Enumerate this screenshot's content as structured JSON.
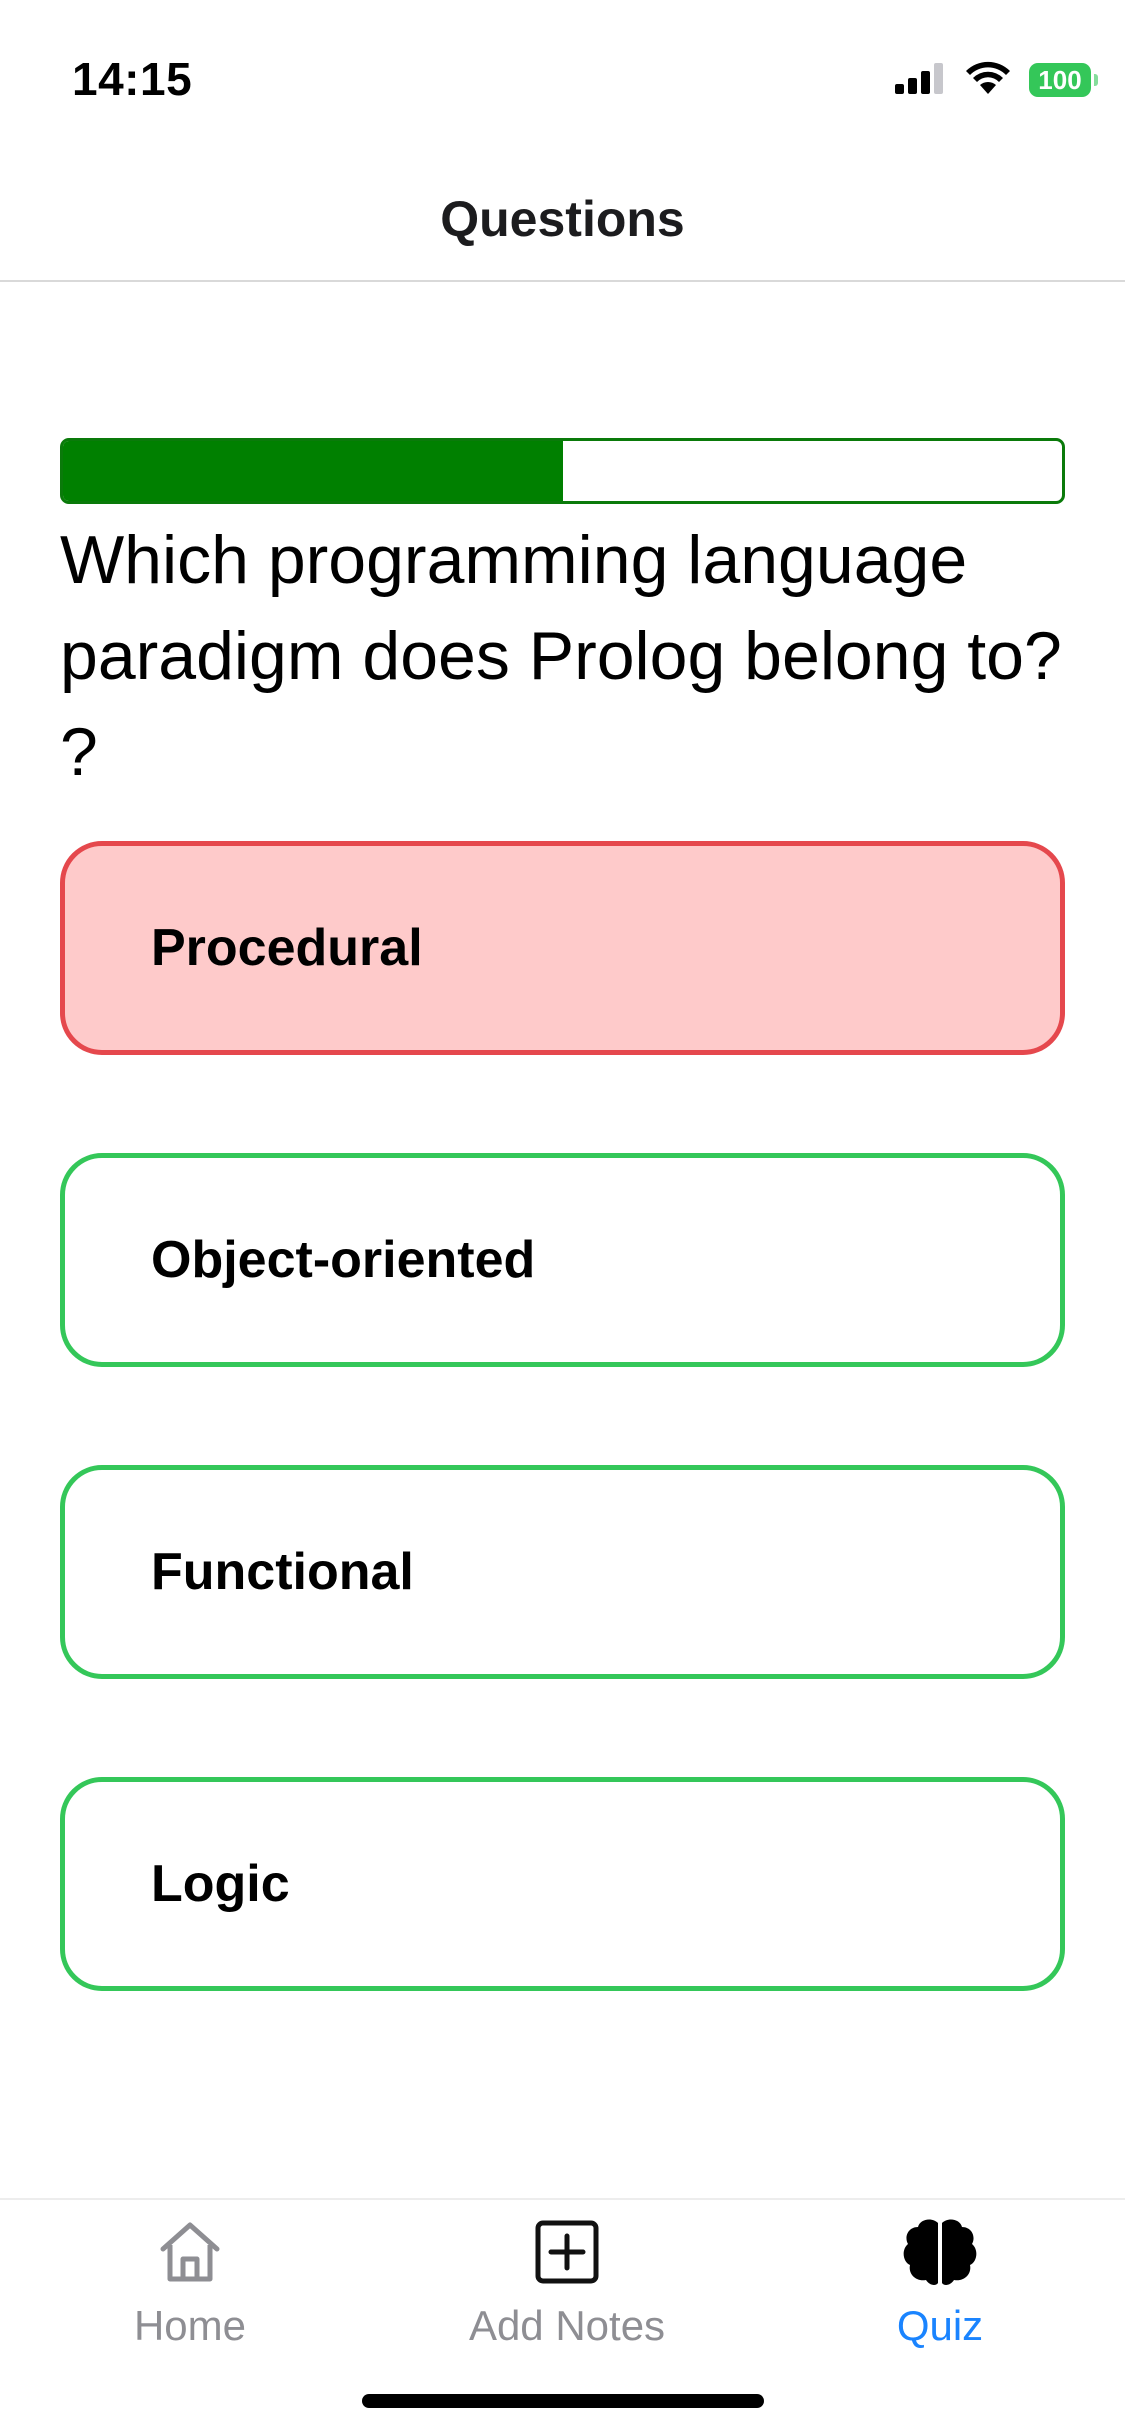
{
  "status_bar": {
    "time": "14:15",
    "battery": "100",
    "icons": [
      "cellular-signal-icon",
      "wifi-icon",
      "battery-icon"
    ]
  },
  "header": {
    "title": "Questions"
  },
  "quiz": {
    "progress": 0.5,
    "question": "Which programming language paradigm does Prolog belong to? ?",
    "answers": [
      {
        "label": "Procedural",
        "state": "wrong"
      },
      {
        "label": "Object-oriented",
        "state": "neutral"
      },
      {
        "label": "Functional",
        "state": "neutral"
      },
      {
        "label": "Logic",
        "state": "neutral"
      }
    ]
  },
  "tab_bar": {
    "tabs": [
      {
        "label": "Home",
        "icon": "home-icon",
        "active": false
      },
      {
        "label": "Add Notes",
        "icon": "add-square-icon",
        "active": false
      },
      {
        "label": "Quiz",
        "icon": "brain-icon",
        "active": true
      }
    ]
  },
  "colors": {
    "progress_fill": "#008000",
    "progress_border": "#0a7a0a",
    "answer_border": "#34c759",
    "wrong_border": "#e5484d",
    "wrong_fill": "#fecaca",
    "active_tab": "#1a84ff",
    "inactive_tab": "#8e8e93",
    "battery": "#34c759"
  }
}
